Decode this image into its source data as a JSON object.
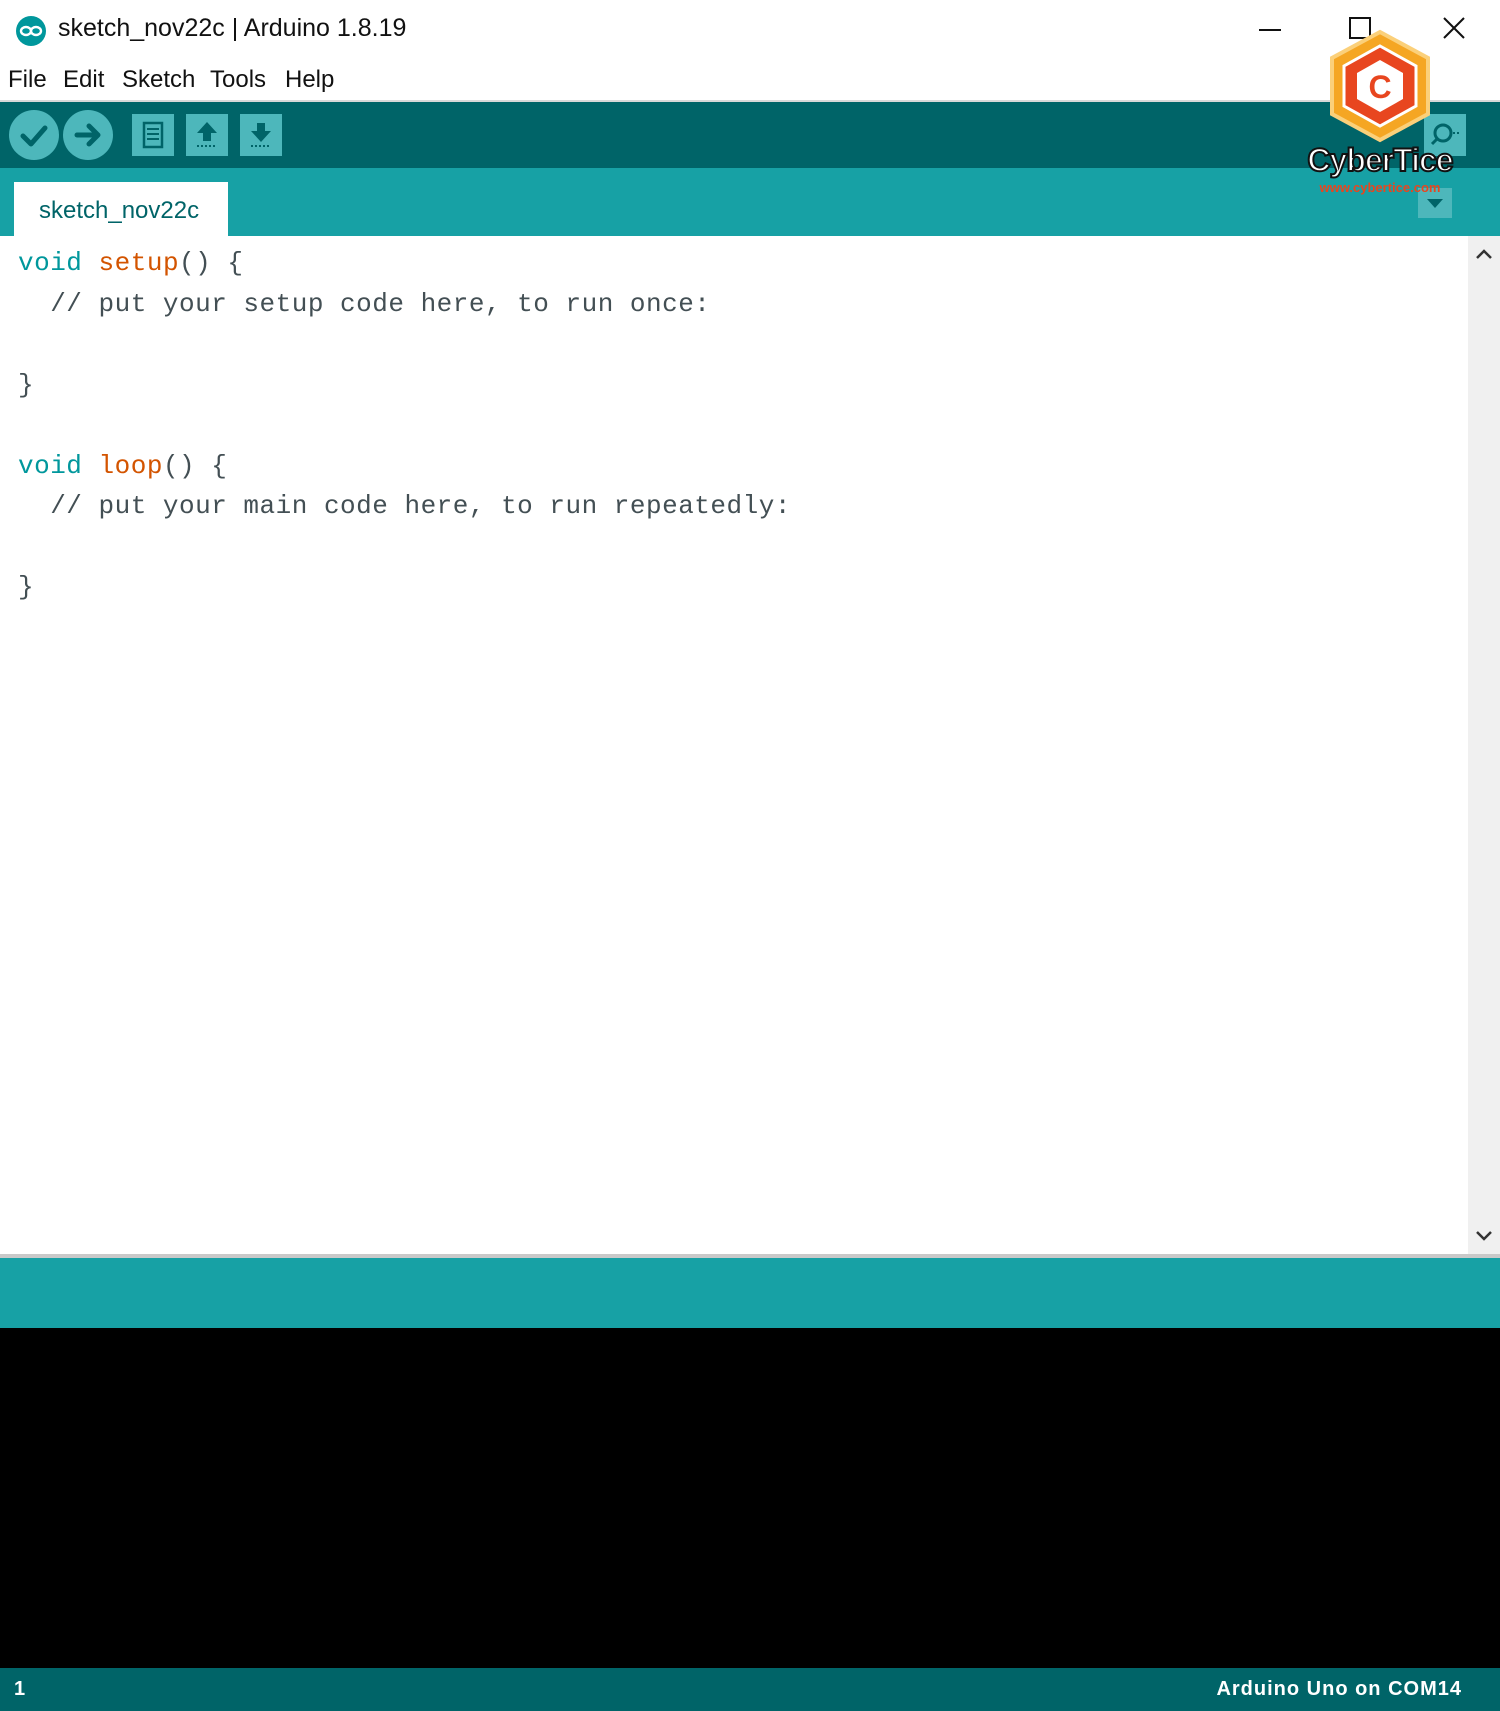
{
  "window": {
    "title": "sketch_nov22c | Arduino 1.8.19",
    "controls": [
      "minimize",
      "maximize",
      "close"
    ]
  },
  "menu": {
    "items": [
      "File",
      "Edit",
      "Sketch",
      "Tools",
      "Help"
    ]
  },
  "toolbar": {
    "buttons": [
      "verify-icon",
      "upload-icon",
      "new-icon",
      "open-icon",
      "save-icon"
    ],
    "serial_monitor": "magnifier-icon"
  },
  "tabs": {
    "active": "sketch_nov22c"
  },
  "editor": {
    "lines": [
      {
        "parts": [
          {
            "t": "void",
            "c": "kw"
          },
          {
            "t": " "
          },
          {
            "t": "setup",
            "c": "fn"
          },
          {
            "t": "() {"
          }
        ]
      },
      {
        "parts": [
          {
            "t": "  // put your setup code here, to run once:",
            "c": "cm"
          }
        ]
      },
      {
        "parts": [
          {
            "t": ""
          }
        ]
      },
      {
        "parts": [
          {
            "t": "}"
          }
        ]
      },
      {
        "parts": [
          {
            "t": ""
          }
        ]
      },
      {
        "parts": [
          {
            "t": "void",
            "c": "kw"
          },
          {
            "t": " "
          },
          {
            "t": "loop",
            "c": "fn"
          },
          {
            "t": "() {"
          }
        ]
      },
      {
        "parts": [
          {
            "t": "  // put your main code here, to run repeatedly:",
            "c": "cm"
          }
        ]
      },
      {
        "parts": [
          {
            "t": ""
          }
        ]
      },
      {
        "parts": [
          {
            "t": "}"
          }
        ]
      }
    ]
  },
  "status": {
    "line_number": "1",
    "board": "Arduino Uno on COM14"
  },
  "watermark": {
    "name": "CyberTice",
    "url": "www.cybertice.com"
  },
  "colors": {
    "toolbar": "#006468",
    "tabstrip": "#17a1a5",
    "button": "#4db7bb",
    "keyword": "#00979c",
    "function": "#d35400"
  }
}
